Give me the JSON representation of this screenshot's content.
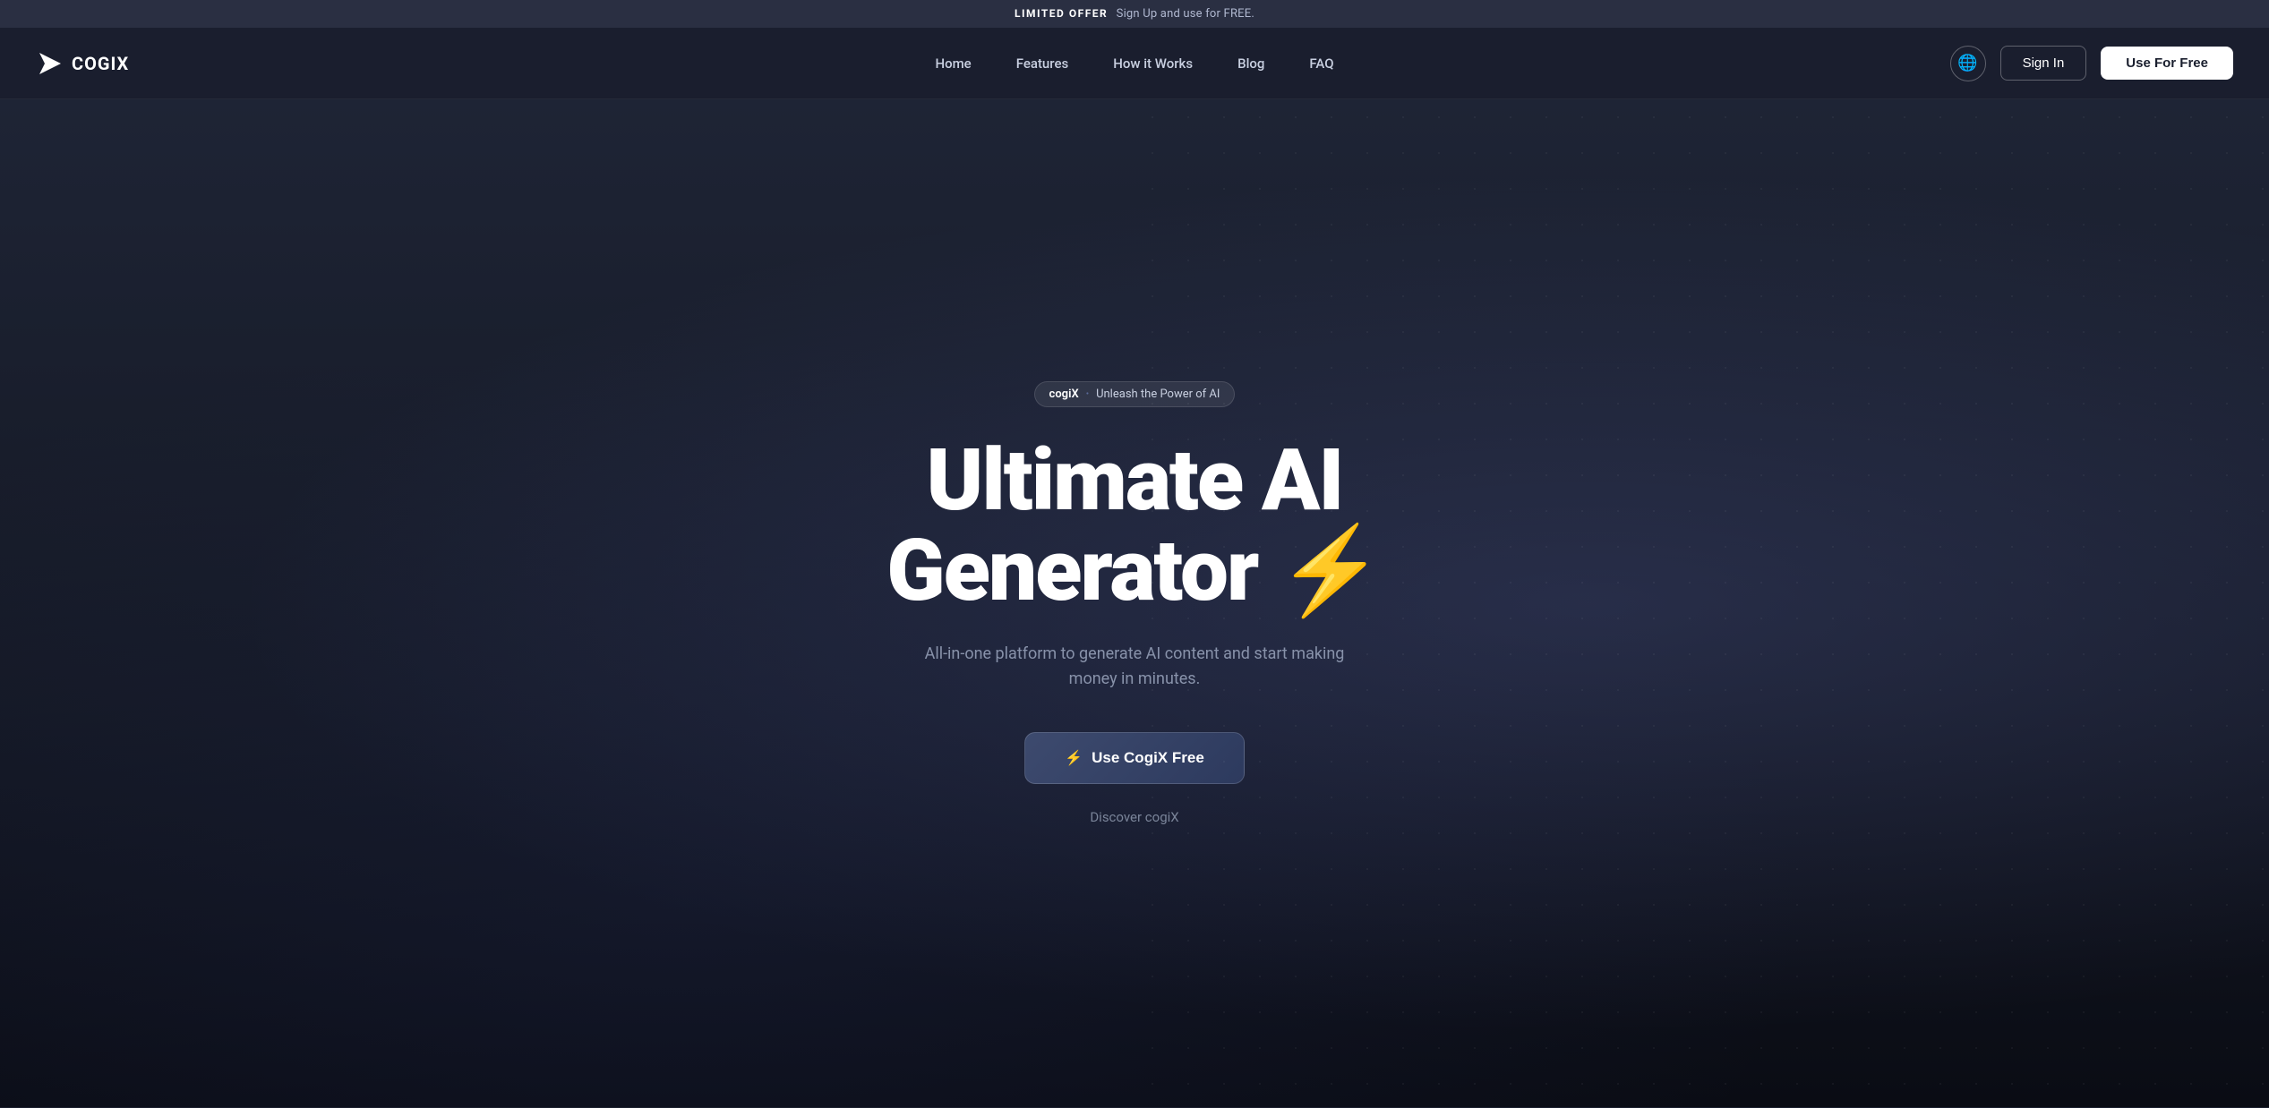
{
  "banner": {
    "highlight": "LIMITED OFFER",
    "text": "Sign Up and use for FREE."
  },
  "navbar": {
    "logo_text": "COGIX",
    "nav_items": [
      {
        "label": "Home",
        "id": "home"
      },
      {
        "label": "Features",
        "id": "features"
      },
      {
        "label": "How it Works",
        "id": "how-it-works"
      },
      {
        "label": "Blog",
        "id": "blog"
      },
      {
        "label": "FAQ",
        "id": "faq"
      }
    ],
    "signin_label": "Sign In",
    "use_free_label": "Use For Free",
    "globe_icon": "🌐"
  },
  "hero": {
    "badge_brand": "cogiX",
    "badge_separator": "•",
    "badge_text": "Unleash the Power of AI",
    "title_line1": "Ultimate AI",
    "title_line2": "Generator",
    "lightning_emoji": "⚡",
    "subtitle": "All-in-one platform to generate AI content and start making money in minutes.",
    "cta_label": "Use CogiX Free",
    "cta_lightning": "⚡",
    "discover_label": "Discover cogiX"
  }
}
